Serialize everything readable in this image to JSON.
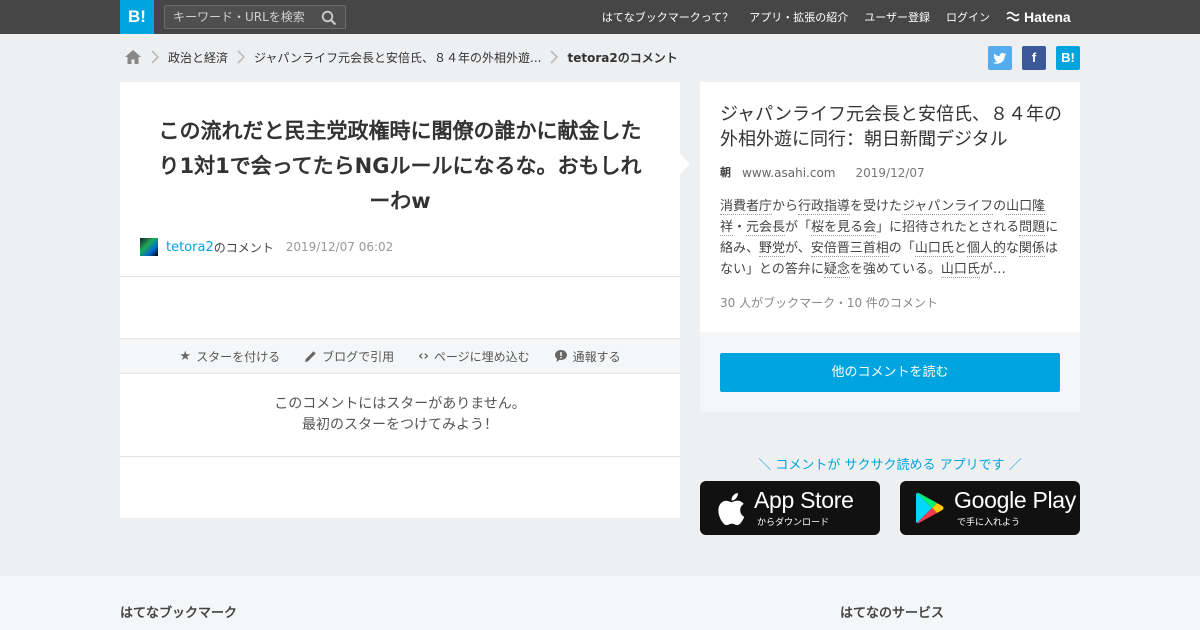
{
  "header": {
    "logo": "B!",
    "search_placeholder": "キーワード・URLを検索",
    "nav": [
      "はてなブックマークって？",
      "アプリ・拡張の紹介",
      "ユーザー登録",
      "ログイン"
    ],
    "brand": "Hatena"
  },
  "breadcrumb": {
    "items": [
      "政治と経済",
      "ジャパンライフ元会長と安倍氏、８４年の外相外遊...",
      "tetora2のコメント"
    ]
  },
  "share": {
    "twitter": "t",
    "facebook": "f",
    "hatebu": "B!"
  },
  "comment": {
    "text": "この流れだと民主党政権時に閣僚の誰かに献金したり1対1で会ってたらNGルールになるな。おもしれーわw",
    "user": "tetora2",
    "user_suffix": "のコメント",
    "date": "2019/12/07 06:02",
    "actions": [
      "スターを付ける",
      "ブログで引用",
      "ページに埋め込む",
      "通報する"
    ],
    "no_star_line1": "このコメントにはスターがありません。",
    "no_star_line2": "最初のスターをつけてみよう！"
  },
  "entry": {
    "title": "ジャパンライフ元会長と安倍氏、８４年の外相外遊に同行：朝日新聞デジタル",
    "favicon": "朝",
    "domain": "www.asahi.com",
    "date": "2019/12/07",
    "description_parts": [
      "消費者庁",
      "から",
      "行政指導",
      "を受けた",
      "ジャパンライフ",
      "の",
      "山口隆祥",
      "・",
      "元会長",
      "が「",
      "桜を見る会",
      "」に招待されたとされる",
      "問題",
      "に絡み、",
      "野党",
      "が、",
      "安倍晋三首相",
      "の「",
      "山口氏",
      "と",
      "個人的",
      "な",
      "関係",
      "はない」との答弁に",
      "疑念",
      "を強めている。",
      "山口氏",
      "が…"
    ],
    "stats": "30 人がブックマーク・10 件のコメント",
    "read_button": "他のコメントを読む"
  },
  "apps": {
    "tagline": "＼ コメントが サクサク読める アプリです ／",
    "appstore_big": "App Store",
    "appstore_small": "からダウンロード",
    "googleplay_big": "Google Play",
    "googleplay_small": "で手に入れよう"
  },
  "footer": {
    "left_heading": "はてなブックマーク",
    "right_heading": "はてなのサービス"
  },
  "colors": {
    "accent": "#00a4de",
    "topbar": "#464646",
    "background": "#eeeff1"
  }
}
